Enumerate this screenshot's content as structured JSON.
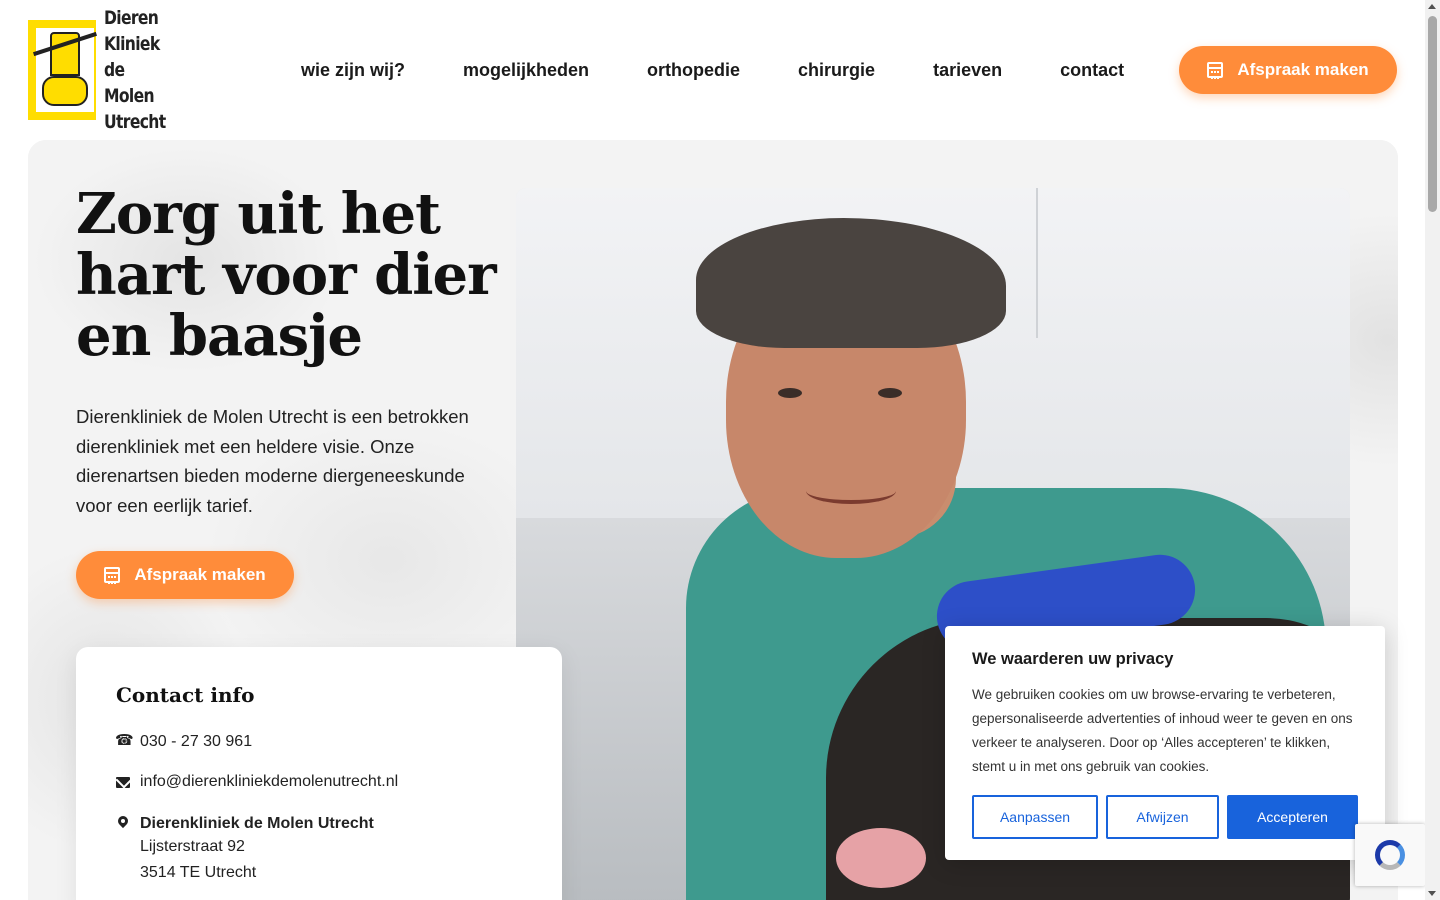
{
  "logo": {
    "lines": [
      "Dieren",
      "Kliniek",
      "de Molen",
      "Utrecht"
    ],
    "color": "#ffdd00"
  },
  "nav": {
    "items": [
      {
        "label": "wie zijn wij?"
      },
      {
        "label": "mogelijkheden"
      },
      {
        "label": "orthopedie"
      },
      {
        "label": "chirurgie"
      },
      {
        "label": "tarieven"
      },
      {
        "label": "contact"
      }
    ],
    "cta": {
      "label": "Afspraak maken",
      "icon": "calendar-icon",
      "color": "#ff8c3a"
    }
  },
  "hero": {
    "title": "Zorg uit het hart voor dier en baasje",
    "text": "Dierenkliniek de Molen Utrecht is een betrokken dierenkliniek met een heldere visie. Onze dierenartsen bieden moderne diergeneeskunde voor een eerlijk tarief.",
    "cta": {
      "label": "Afspraak maken",
      "icon": "calendar-icon"
    },
    "photo": {
      "subject": "vet-with-dog-photo"
    }
  },
  "contact": {
    "title": "Contact info",
    "phone": "030 - 27 30 961",
    "email": "info@dierenkliniekdemolenutrecht.nl",
    "address": {
      "name": "Dierenkliniek de Molen Utrecht",
      "street": "Lijsterstraat 92",
      "city": "3514 TE Utrecht"
    }
  },
  "cookie": {
    "title": "We waarderen uw privacy",
    "text": "We gebruiken cookies om uw browse-ervaring te verbeteren, gepersonaliseerde advertenties of inhoud weer te geven en ons verkeer te analyseren. Door op ‘Alles accepteren’ te klikken, stemt u in met ons gebruik van cookies.",
    "buttons": {
      "customize": "Aanpassen",
      "reject": "Afwijzen",
      "accept": "Accepteren"
    },
    "accent": "#1863dc"
  }
}
